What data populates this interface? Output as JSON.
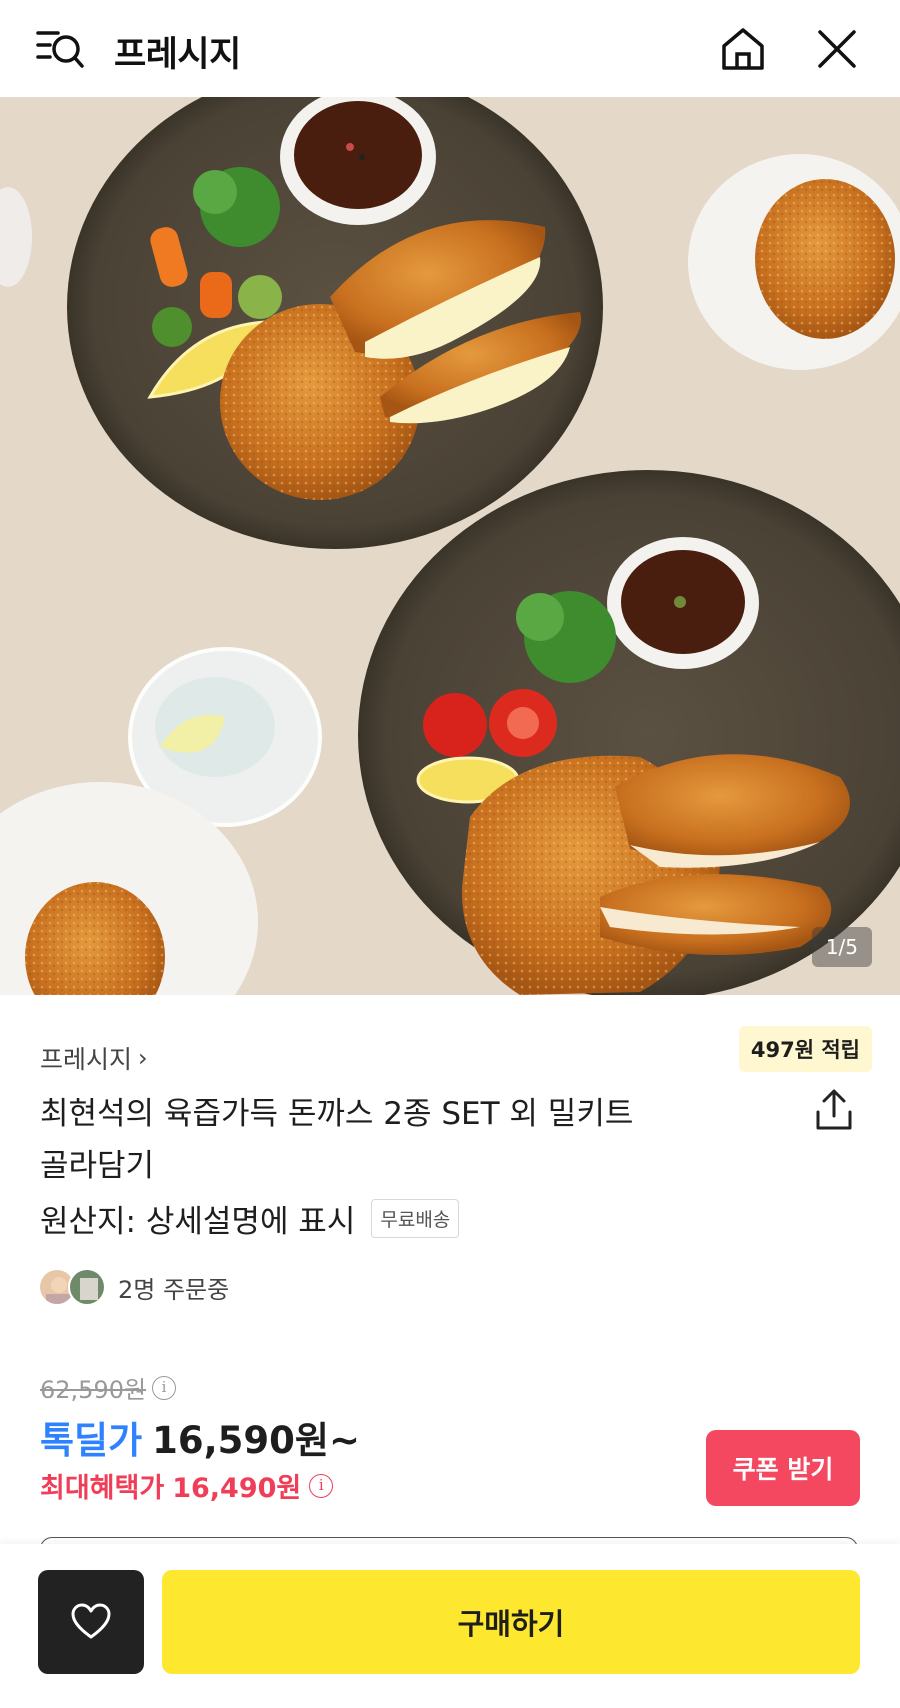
{
  "header": {
    "brand": "프레시지",
    "icons": {
      "menu": "menu-search-icon",
      "home": "home-icon",
      "close": "close-icon"
    }
  },
  "gallery": {
    "counter": "1/5",
    "current": 1,
    "total": 5
  },
  "product": {
    "seller": "프레시지",
    "seller_chevron": "›",
    "point_tag": "497원 적립",
    "title_line1": "최현석의 육즙가득 돈까스 2종 SET 외 밀키트",
    "title_line2": "골라담기",
    "origin": "원산지: 상세설명에 표시",
    "shipping_badge": "무료배송",
    "orders_text": "2명 주문중"
  },
  "price": {
    "original": "62,590원",
    "deal_label": "톡딜가",
    "deal_price": "16,590원~",
    "max_benefit_label": "최대혜택가",
    "max_benefit_price": "16,490원",
    "info_glyph": "i",
    "coupon_button": "쿠폰 받기"
  },
  "bottom_bar": {
    "buy_button": "구매하기",
    "wish_icon": "heart-icon"
  },
  "colors": {
    "deal_blue": "#2f82ff",
    "benefit_red": "#f03e58",
    "coupon_bg": "#f3485f",
    "buy_yellow": "#fde72f",
    "wish_dark": "#222222"
  }
}
